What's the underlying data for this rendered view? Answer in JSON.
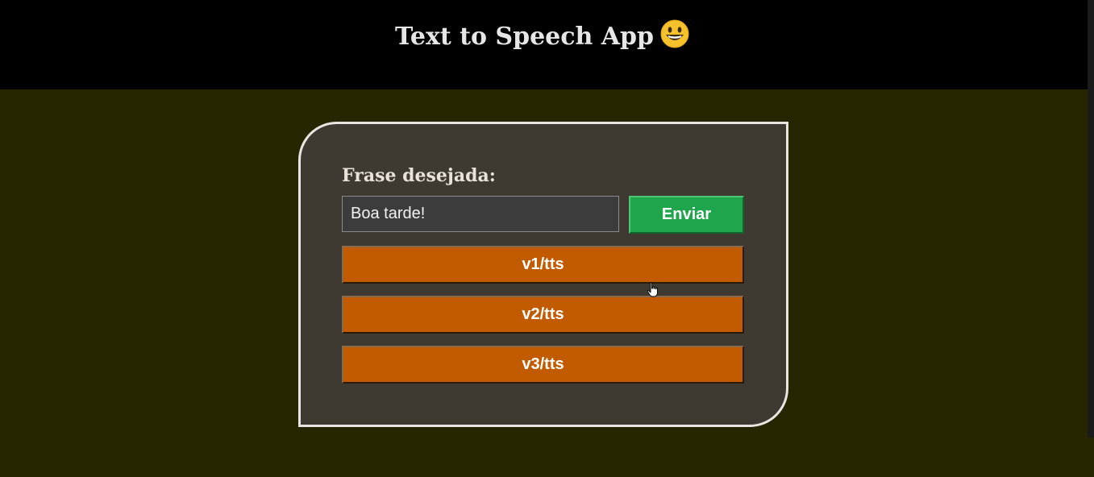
{
  "header": {
    "title": "Text to Speech App",
    "emoji_icon": "grinning-face-emoji"
  },
  "form": {
    "label": "Frase desejada:",
    "input_value": "Boa tarde!",
    "send_label": "Enviar"
  },
  "tts_buttons": [
    {
      "label": "v1/tts"
    },
    {
      "label": "v2/tts"
    },
    {
      "label": "v3/tts"
    }
  ],
  "colors": {
    "header_bg": "#000000",
    "page_bg": "#262601",
    "card_bg": "#3f3a31",
    "send_button": "#1fa64c",
    "tts_button": "#c25a00"
  }
}
